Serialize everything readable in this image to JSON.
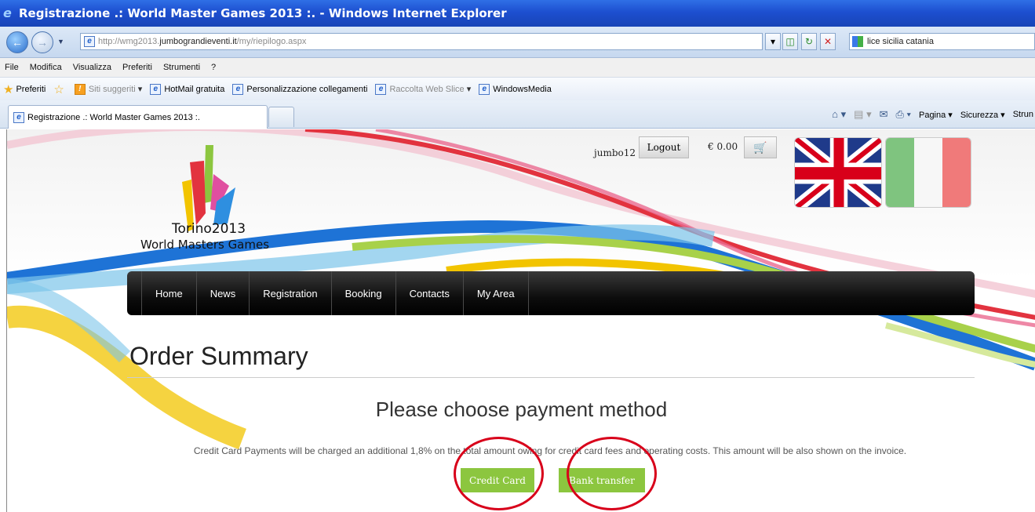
{
  "window": {
    "title": "Registrazione .: World Master Games 2013 :. - Windows Internet Explorer"
  },
  "address_bar": {
    "url_prefix": "http://wmg2013.",
    "url_domain": "jumbograndieventi.it",
    "url_path": "/my/riepilogo.aspx",
    "search_text": "lice sicilia catania"
  },
  "menu": [
    "File",
    "Modifica",
    "Visualizza",
    "Preferiti",
    "Strumenti",
    "?"
  ],
  "favorites_bar": {
    "favorites_label": "Preferiti",
    "items": [
      "Siti suggeriti",
      "HotMail gratuita",
      "Personalizzazione collegamenti",
      "Raccolta Web Slice",
      "WindowsMedia"
    ]
  },
  "tab": {
    "title": "Registrazione .: World Master Games 2013 :."
  },
  "command_bar": {
    "page": "Pagina",
    "security": "Sicurezza",
    "tools": "Strun"
  },
  "site": {
    "logo_line1": "Torino2013",
    "logo_line2": "World Masters Games",
    "username": "jumbo12",
    "logout": "Logout",
    "cart_total": "€ 0.00",
    "nav": [
      "Home",
      "News",
      "Registration",
      "Booking",
      "Contacts",
      "My Area"
    ],
    "page_title": "Order Summary",
    "subtitle": "Please choose payment method",
    "note": "Credit Card Payments will be charged an additional 1,8% on the total amount owing for credit card fees and operating costs. This amount will be also shown on the invoice.",
    "btn_credit": "Credit Card",
    "btn_bank": "Bank transfer"
  },
  "colors": {
    "pay_button": "#8cc63f",
    "annotation_circle": "#d8001a",
    "nav_bar": "#111111"
  }
}
